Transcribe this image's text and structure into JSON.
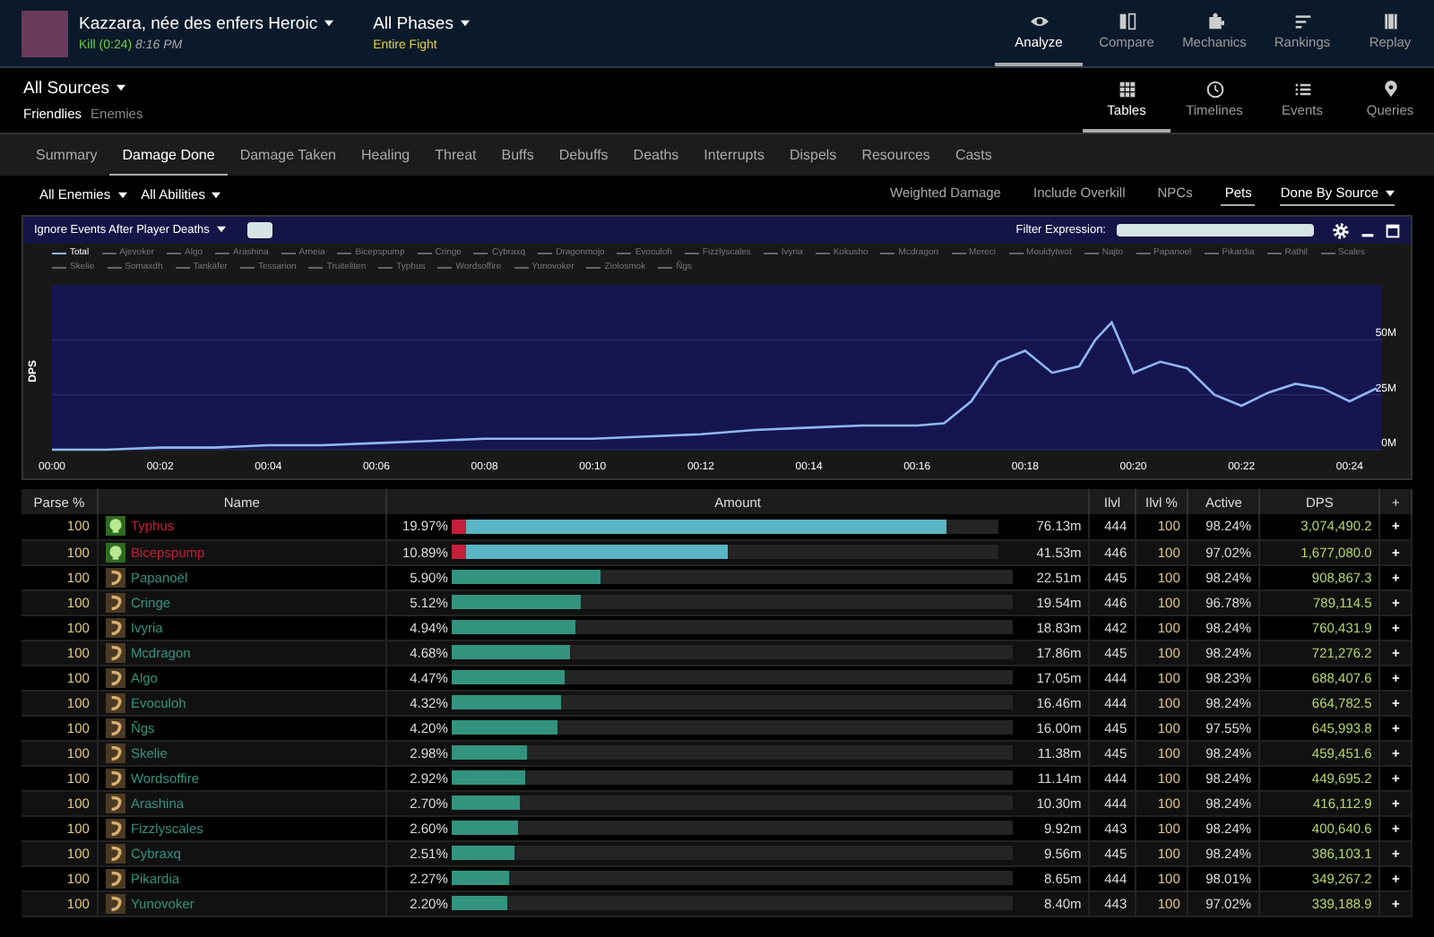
{
  "header": {
    "encounter": "Kazzara, née des enfers Heroic",
    "result": "Kill (0:24)",
    "time": "8:16 PM",
    "phase": "All Phases",
    "phase_sub": "Entire Fight"
  },
  "main_nav": [
    {
      "label": "Analyze",
      "selected": true
    },
    {
      "label": "Compare",
      "selected": false
    },
    {
      "label": "Mechanics",
      "selected": false
    },
    {
      "label": "Rankings",
      "selected": false
    },
    {
      "label": "Replay",
      "selected": false
    }
  ],
  "sources": {
    "label": "All Sources",
    "options": [
      {
        "label": "Friendlies",
        "selected": true
      },
      {
        "label": "Enemies",
        "selected": false
      }
    ]
  },
  "view_nav": [
    {
      "label": "Tables",
      "selected": true
    },
    {
      "label": "Timelines",
      "selected": false
    },
    {
      "label": "Events",
      "selected": false
    },
    {
      "label": "Queries",
      "selected": false
    }
  ],
  "tabs": [
    {
      "label": "Summary",
      "selected": false
    },
    {
      "label": "Damage Done",
      "selected": true
    },
    {
      "label": "Damage Taken",
      "selected": false
    },
    {
      "label": "Healing",
      "selected": false
    },
    {
      "label": "Threat",
      "selected": false
    },
    {
      "label": "Buffs",
      "selected": false
    },
    {
      "label": "Debuffs",
      "selected": false
    },
    {
      "label": "Deaths",
      "selected": false
    },
    {
      "label": "Interrupts",
      "selected": false
    },
    {
      "label": "Dispels",
      "selected": false
    },
    {
      "label": "Resources",
      "selected": false
    },
    {
      "label": "Casts",
      "selected": false
    }
  ],
  "filters": {
    "dropdowns": [
      "All Enemies",
      "All Abilities"
    ],
    "toggles": [
      {
        "label": "Weighted Damage",
        "selected": false
      },
      {
        "label": "Include Overkill",
        "selected": false
      },
      {
        "label": "NPCs",
        "selected": false
      },
      {
        "label": "Pets",
        "selected": true
      }
    ],
    "mode": "Done By Source"
  },
  "graph": {
    "option": "Ignore Events After Player Deaths",
    "filter_label": "Filter Expression:",
    "legend": [
      {
        "label": "Ajevoker",
        "selected": false
      },
      {
        "label": "Algo",
        "selected": false
      },
      {
        "label": "Arashina",
        "selected": false
      },
      {
        "label": "Arneia",
        "selected": false
      },
      {
        "label": "Bicepspump",
        "selected": false
      },
      {
        "label": "Cringe",
        "selected": false
      },
      {
        "label": "Cybraxq",
        "selected": false
      },
      {
        "label": "Dragonmojo",
        "selected": false
      },
      {
        "label": "Evoculoh",
        "selected": false
      },
      {
        "label": "Fizzlyscales",
        "selected": false
      },
      {
        "label": "Ivyria",
        "selected": false
      },
      {
        "label": "Kokusho",
        "selected": false
      },
      {
        "label": "Mcdragon",
        "selected": false
      },
      {
        "label": "Mereci",
        "selected": false
      },
      {
        "label": "Mouldytwot",
        "selected": false
      },
      {
        "label": "Najto",
        "selected": false
      },
      {
        "label": "Papanoel",
        "selected": false
      },
      {
        "label": "Pikardia",
        "selected": false
      },
      {
        "label": "Rathil",
        "selected": false
      },
      {
        "label": "Scales",
        "selected": false
      },
      {
        "label": "Skelie",
        "selected": false
      },
      {
        "label": "Somaxdh",
        "selected": false
      },
      {
        "label": "Tankäfer",
        "selected": false
      },
      {
        "label": "Tessarion",
        "selected": false
      },
      {
        "label": "Truiteliten",
        "selected": false
      },
      {
        "label": "Typhus",
        "selected": false
      },
      {
        "label": "Wordsoffire",
        "selected": false
      },
      {
        "label": "Yunovoker",
        "selected": false
      },
      {
        "label": "Ziolosmok",
        "selected": false
      },
      {
        "label": "Ñgs",
        "selected": false
      }
    ],
    "chart_data": {
      "type": "line",
      "ylabel": "DPS",
      "x": [
        0,
        1,
        2,
        3,
        4,
        5,
        6,
        7,
        8,
        9,
        10,
        11,
        12,
        13,
        14,
        15,
        16,
        16.5,
        17,
        17.5,
        18,
        18.5,
        19,
        19.3,
        19.6,
        20,
        20.5,
        21,
        21.5,
        22,
        22.5,
        23,
        23.5,
        24,
        24.5
      ],
      "series": [
        {
          "name": "Total",
          "color": "#8fb8f0",
          "values": [
            0,
            0,
            1,
            1,
            2,
            2,
            3,
            4,
            5,
            5,
            5,
            6,
            7,
            9,
            10,
            11,
            11,
            12,
            22,
            40,
            45,
            35,
            38,
            50,
            58,
            35,
            40,
            37,
            25,
            20,
            26,
            30,
            28,
            22,
            28
          ]
        }
      ],
      "xlim": [
        0,
        24.6
      ],
      "ylim": [
        0,
        75
      ],
      "xticks": [
        {
          "value": 0,
          "label": "00:00"
        },
        {
          "value": 2,
          "label": "00:02"
        },
        {
          "value": 4,
          "label": "00:04"
        },
        {
          "value": 6,
          "label": "00:06"
        },
        {
          "value": 8,
          "label": "00:08"
        },
        {
          "value": 10,
          "label": "00:10"
        },
        {
          "value": 12,
          "label": "00:12"
        },
        {
          "value": 14,
          "label": "00:14"
        },
        {
          "value": 16,
          "label": "00:16"
        },
        {
          "value": 18,
          "label": "00:18"
        },
        {
          "value": 20,
          "label": "00:20"
        },
        {
          "value": 22,
          "label": "00:22"
        },
        {
          "value": 24,
          "label": "00:24"
        }
      ],
      "yticks": [
        {
          "value": 0,
          "label": "0M"
        },
        {
          "value": 25,
          "label": "25M"
        },
        {
          "value": 50,
          "label": "50M"
        }
      ]
    }
  },
  "table": {
    "columns": [
      "Parse %",
      "Name",
      "Amount",
      "Ilvl",
      "Ilvl %",
      "Active",
      "DPS",
      "+"
    ],
    "rows": [
      {
        "kind": "pet",
        "parse": "100",
        "name": "Typhus",
        "percent": "19.97%",
        "level": 0.9,
        "amount": "76.13m",
        "ilvl": "444",
        "ilvl_pct": "100",
        "active": "98.24%",
        "dps": "3,074,490.2"
      },
      {
        "kind": "pet",
        "parse": "100",
        "name": "Bicepspump",
        "percent": "10.89%",
        "level": 0.49,
        "amount": "41.53m",
        "ilvl": "446",
        "ilvl_pct": "100",
        "active": "97.02%",
        "dps": "1,677,080.0"
      },
      {
        "kind": "player",
        "parse": "100",
        "name": "Papanoël",
        "percent": "5.90%",
        "level": 0.265,
        "amount": "22.51m",
        "ilvl": "445",
        "ilvl_pct": "100",
        "active": "98.24%",
        "dps": "908,867.3"
      },
      {
        "kind": "player",
        "parse": "100",
        "name": "Cringe",
        "percent": "5.12%",
        "level": 0.23,
        "amount": "19.54m",
        "ilvl": "446",
        "ilvl_pct": "100",
        "active": "96.78%",
        "dps": "789,114.5"
      },
      {
        "kind": "player",
        "parse": "100",
        "name": "Ivyria",
        "percent": "4.94%",
        "level": 0.222,
        "amount": "18.83m",
        "ilvl": "442",
        "ilvl_pct": "100",
        "active": "98.24%",
        "dps": "760,431.9"
      },
      {
        "kind": "player",
        "parse": "100",
        "name": "Mcdragon",
        "percent": "4.68%",
        "level": 0.211,
        "amount": "17.86m",
        "ilvl": "445",
        "ilvl_pct": "100",
        "active": "98.24%",
        "dps": "721,276.2"
      },
      {
        "kind": "player",
        "parse": "100",
        "name": "Algo",
        "percent": "4.47%",
        "level": 0.201,
        "amount": "17.05m",
        "ilvl": "444",
        "ilvl_pct": "100",
        "active": "98.23%",
        "dps": "688,407.6"
      },
      {
        "kind": "player",
        "parse": "100",
        "name": "Evoculoh",
        "percent": "4.32%",
        "level": 0.194,
        "amount": "16.46m",
        "ilvl": "444",
        "ilvl_pct": "100",
        "active": "98.24%",
        "dps": "664,782.5"
      },
      {
        "kind": "player",
        "parse": "100",
        "name": "Ñgs",
        "percent": "4.20%",
        "level": 0.189,
        "amount": "16.00m",
        "ilvl": "445",
        "ilvl_pct": "100",
        "active": "97.55%",
        "dps": "645,993.8"
      },
      {
        "kind": "player",
        "parse": "100",
        "name": "Skelie",
        "percent": "2.98%",
        "level": 0.134,
        "amount": "11.38m",
        "ilvl": "445",
        "ilvl_pct": "100",
        "active": "98.24%",
        "dps": "459,451.6"
      },
      {
        "kind": "player",
        "parse": "100",
        "name": "Wordsoffire",
        "percent": "2.92%",
        "level": 0.131,
        "amount": "11.14m",
        "ilvl": "444",
        "ilvl_pct": "100",
        "active": "98.24%",
        "dps": "449,695.2"
      },
      {
        "kind": "player",
        "parse": "100",
        "name": "Arashina",
        "percent": "2.70%",
        "level": 0.122,
        "amount": "10.30m",
        "ilvl": "444",
        "ilvl_pct": "100",
        "active": "98.24%",
        "dps": "416,112.9"
      },
      {
        "kind": "player",
        "parse": "100",
        "name": "Fizzlyscales",
        "percent": "2.60%",
        "level": 0.117,
        "amount": "9.92m",
        "ilvl": "443",
        "ilvl_pct": "100",
        "active": "98.24%",
        "dps": "400,640.6"
      },
      {
        "kind": "player",
        "parse": "100",
        "name": "Cybraxq",
        "percent": "2.51%",
        "level": 0.113,
        "amount": "9.56m",
        "ilvl": "445",
        "ilvl_pct": "100",
        "active": "98.24%",
        "dps": "386,103.1"
      },
      {
        "kind": "player",
        "parse": "100",
        "name": "Pikardia",
        "percent": "2.27%",
        "level": 0.102,
        "amount": "8.65m",
        "ilvl": "444",
        "ilvl_pct": "100",
        "active": "98.01%",
        "dps": "349,267.2"
      },
      {
        "kind": "player",
        "parse": "100",
        "name": "Yunovoker",
        "percent": "2.20%",
        "level": 0.099,
        "amount": "8.40m",
        "ilvl": "443",
        "ilvl_pct": "100",
        "active": "97.02%",
        "dps": "339,188.9"
      }
    ]
  }
}
